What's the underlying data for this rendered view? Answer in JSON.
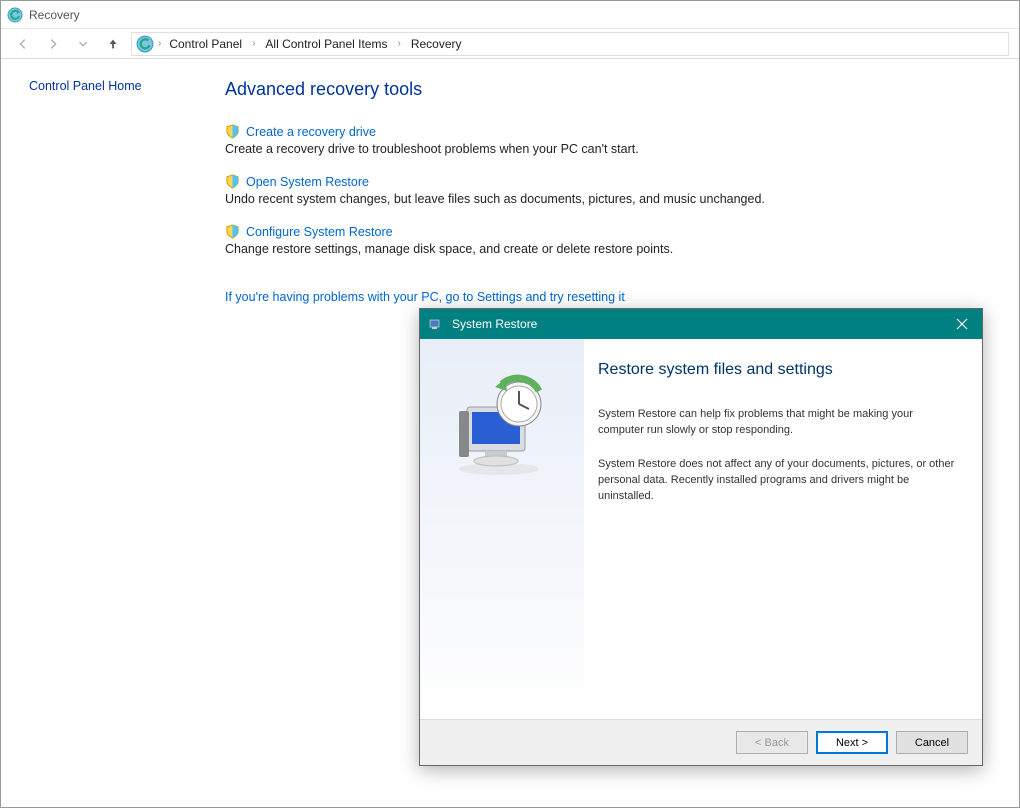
{
  "window": {
    "title": "Recovery"
  },
  "breadcrumbs": {
    "items": [
      "Control Panel",
      "All Control Panel Items",
      "Recovery"
    ]
  },
  "sidebar": {
    "home_link": "Control Panel Home"
  },
  "main": {
    "heading": "Advanced recovery tools",
    "tools": [
      {
        "link": "Create a recovery drive",
        "desc": "Create a recovery drive to troubleshoot problems when your PC can't start."
      },
      {
        "link": "Open System Restore",
        "desc": "Undo recent system changes, but leave files such as documents, pictures, and music unchanged."
      },
      {
        "link": "Configure System Restore",
        "desc": "Change restore settings, manage disk space, and create or delete restore points."
      }
    ],
    "reset_link": "If you're having problems with your PC, go to Settings and try resetting it"
  },
  "dialog": {
    "title": "System Restore",
    "heading": "Restore system files and settings",
    "para1": "System Restore can help fix problems that might be making your computer run slowly or stop responding.",
    "para2": "System Restore does not affect any of your documents, pictures, or other personal data. Recently installed programs and drivers might be uninstalled.",
    "buttons": {
      "back": "< Back",
      "next": "Next >",
      "cancel": "Cancel"
    }
  }
}
